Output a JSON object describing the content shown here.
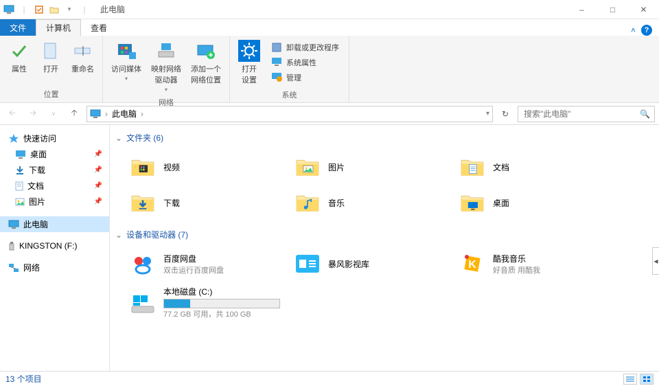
{
  "title": "此电脑",
  "window_controls": {
    "min": "–",
    "max": "□",
    "close": "✕"
  },
  "tabs": {
    "file": "文件",
    "computer": "计算机",
    "view": "查看"
  },
  "ribbon": {
    "location": {
      "label": "位置",
      "properties": "属性",
      "open": "打开",
      "rename": "重命名"
    },
    "network": {
      "label": "网络",
      "media": "访问媒体",
      "map": "映射网络\n驱动器",
      "addloc": "添加一个\n网络位置"
    },
    "system": {
      "label": "系统",
      "opensettings": "打开\n设置",
      "uninstall": "卸载或更改程序",
      "sysprop": "系统属性",
      "manage": "管理"
    }
  },
  "address": {
    "root_icon": "pc",
    "path": "此电脑",
    "dropdown": "▾",
    "refresh": "↻",
    "search_placeholder": "搜索\"此电脑\""
  },
  "nav": [
    {
      "label": "快速访问",
      "icon": "star",
      "top": true
    },
    {
      "label": "桌面",
      "icon": "desktop",
      "pin": true
    },
    {
      "label": "下载",
      "icon": "download",
      "pin": true
    },
    {
      "label": "文档",
      "icon": "doc",
      "pin": true
    },
    {
      "label": "图片",
      "icon": "pic",
      "pin": true
    },
    {
      "label": "此电脑",
      "icon": "pc",
      "top": true,
      "sel": true
    },
    {
      "label": "KINGSTON (F:)",
      "icon": "usb",
      "top": true
    },
    {
      "label": "网络",
      "icon": "net",
      "top": true
    }
  ],
  "groups": [
    {
      "header": "文件夹 (6)",
      "items": [
        {
          "label": "视频",
          "icon": "folder-video"
        },
        {
          "label": "图片",
          "icon": "folder-pic"
        },
        {
          "label": "文档",
          "icon": "folder-doc"
        },
        {
          "label": "下载",
          "icon": "folder-dl"
        },
        {
          "label": "音乐",
          "icon": "folder-music"
        },
        {
          "label": "桌面",
          "icon": "folder-desktop"
        }
      ]
    },
    {
      "header": "设备和驱动器 (7)",
      "items": [
        {
          "label": "百度网盘",
          "sub": "双击运行百度网盘",
          "icon": "baidu"
        },
        {
          "label": "暴风影视库",
          "icon": "baofeng"
        },
        {
          "label": "酷我音乐",
          "sub": "好音质 用酷我",
          "icon": "kuwo"
        },
        {
          "label": "本地磁盘 (C:)",
          "sub": "77.2 GB 可用，共 100 GB",
          "icon": "drive",
          "bar": 22.8
        }
      ]
    }
  ],
  "status": {
    "count": "13 个项目"
  }
}
